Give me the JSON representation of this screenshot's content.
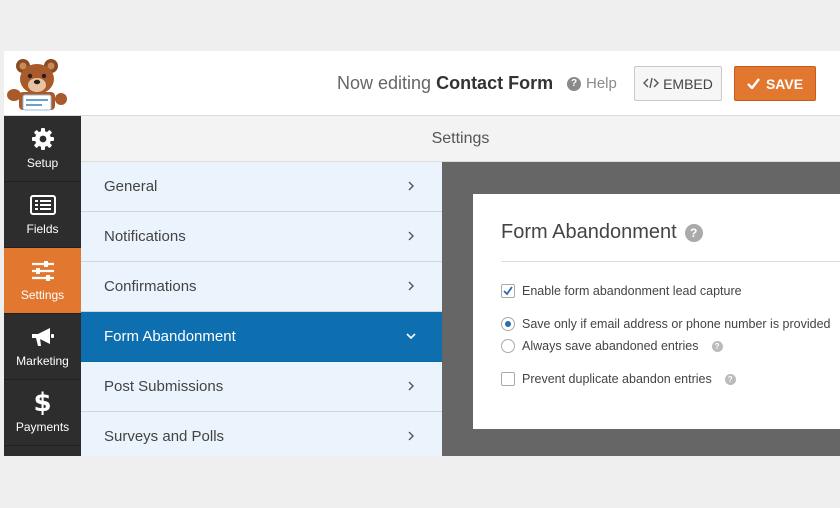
{
  "header": {
    "editing_prefix": "Now editing",
    "form_name": "Contact Form",
    "help_label": "Help",
    "embed_label": "EMBED",
    "save_label": "SAVE"
  },
  "leftnav": {
    "items": [
      {
        "label": "Setup",
        "icon": "gear-icon"
      },
      {
        "label": "Fields",
        "icon": "fields-icon"
      },
      {
        "label": "Settings",
        "icon": "sliders-icon",
        "active": true
      },
      {
        "label": "Marketing",
        "icon": "megaphone-icon"
      },
      {
        "label": "Payments",
        "icon": "dollar-icon"
      }
    ]
  },
  "settings": {
    "title": "Settings",
    "menu": [
      {
        "label": "General"
      },
      {
        "label": "Notifications"
      },
      {
        "label": "Confirmations"
      },
      {
        "label": "Form Abandonment",
        "active": true
      },
      {
        "label": "Post Submissions"
      },
      {
        "label": "Surveys and Polls"
      }
    ]
  },
  "panel": {
    "title": "Form Abandonment",
    "enable_label": "Enable form abandonment lead capture",
    "enable_checked": true,
    "radio_save_only_label": "Save only if email address or phone number is provided",
    "radio_always_label": "Always save abandoned entries",
    "selected_radio": "save_only",
    "prevent_duplicate_label": "Prevent duplicate abandon entries",
    "prevent_duplicate_checked": false
  },
  "colors": {
    "accent_orange": "#e27730",
    "active_blue": "#0e6fb0",
    "nav_dark": "#2d2d2d"
  }
}
